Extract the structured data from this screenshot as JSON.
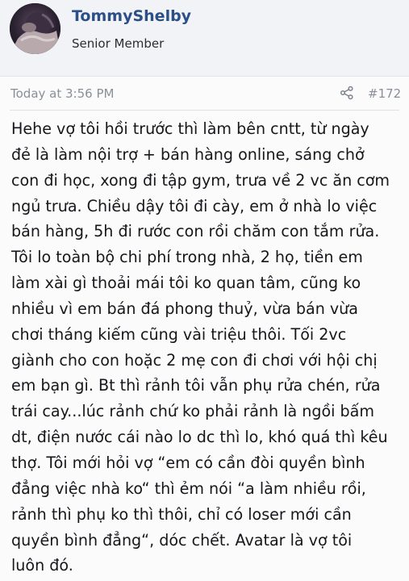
{
  "user": {
    "name": "TommyShelby",
    "title": "Senior Member",
    "avatar_icon": "avatar-photo"
  },
  "post_meta": {
    "timestamp": "Today at 3:56 PM",
    "share_icon": "share-icon",
    "post_number": "#172"
  },
  "post": {
    "body": "Hehe vợ tôi hồi trước thì làm bên cntt, từ ngày\nđẻ là làm nội trợ + bán hàng online, sáng chở\ncon đi học, xong đi tập gym, trưa về 2 vc ăn cơm\nngủ trưa. Chiều dậy tôi đi cày, em ở nhà lo việc\nbán hàng, 5h đi rước con rồi chăm con tắm rửa.\nTôi lo toàn bộ chi phí trong nhà, 2 họ, tiền em\nlàm xài gì thoải mái tôi ko quan tâm, cũng ko\nnhiều vì em bán đá phong thuỷ, vừa bán vừa\nchơi tháng kiếm cũng vài triệu thôi. Tối 2vc\ngiành cho con hoặc 2 mẹ con đi chơi với hội chị\nem bạn gì. Bt thì rảnh tôi vẫn phụ rửa chén, rửa\ntrái cay...lúc rảnh chứ ko phải rảnh là ngồi bấm\ndt, điện nước cái nào lo dc thì lo, khó quá thì kêu\nthợ. Tôi mới hỏi vợ “em có cần đòi quyền bình\nđẳng việc nhà ko“ thì ẻm nói “a làm nhiều rồi,\nrảnh thì phụ ko thì thôi, chỉ có loser mới cần\nquyền bình đẳng“, dóc chết. Avatar là vợ tôi\nluôn đó."
  },
  "colors": {
    "username": "#2b4f86",
    "header_bg": "#f1f3f6",
    "meta_text": "#8a8f98",
    "body_text": "#15171a"
  }
}
